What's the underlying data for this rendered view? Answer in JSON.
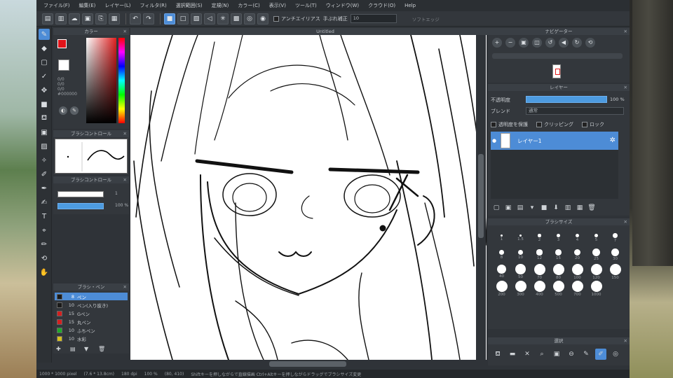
{
  "menu": [
    "ファイル(F)",
    "編集(E)",
    "レイヤー(L)",
    "フィルタ(R)",
    "選択範囲(S)",
    "定規(N)",
    "カラー(C)",
    "表示(V)",
    "ツール(T)",
    "ウィンドウ(W)",
    "クラウド(O)",
    "Help"
  ],
  "toolbar": {
    "antialias_label": "アンチエイリアス",
    "correction_label": "手ぶれ補正",
    "correction_value": "10",
    "soft_label": "ソフトエッジ"
  },
  "panels": {
    "color": "カラー",
    "brush_control": "ブラシコントロール",
    "brush_list": "ブラシ・ペン",
    "navigator": "ナビゲーター",
    "layer": "レイヤー",
    "brush_size": "ブラシサイズ",
    "nav_bottom": "選択"
  },
  "color": {
    "rgb": [
      "0/0",
      "0/0",
      "0/0"
    ],
    "hex": "#000000"
  },
  "cursor_opacity": "100 %",
  "cursor_size": "1",
  "canvas": {
    "title": "Untitled"
  },
  "pens": [
    {
      "size": "8",
      "name": "ペン",
      "color": "#1a1a1a",
      "active": true
    },
    {
      "size": "10",
      "name": "ペン(入り抜き)",
      "color": "#1a1a1a",
      "active": false
    },
    {
      "size": "15",
      "name": "Gペン",
      "color": "#d42020",
      "active": false
    },
    {
      "size": "15",
      "name": "丸ペン",
      "color": "#d42020",
      "active": false
    },
    {
      "size": "10",
      "name": "ふちペン",
      "color": "#1faa2a",
      "active": false
    },
    {
      "size": "10",
      "name": "水彩",
      "color": "#d6c020",
      "active": false
    }
  ],
  "layer": {
    "opacity_label": "不透明度",
    "opacity_value": "100 %",
    "blend_label": "ブレンド",
    "blend_value": "通常",
    "protect_label": "透明度を保護",
    "clipping_label": "クリッピング",
    "lock_label": "ロック",
    "name": "レイヤー1"
  },
  "brush_sizes": [
    "1",
    "1.5",
    "2",
    "3",
    "4",
    "5",
    "7",
    "8",
    "10",
    "12",
    "15",
    "20",
    "25",
    "30",
    "40",
    "50",
    "70",
    "80",
    "100",
    "120",
    "150",
    "200",
    "300",
    "400",
    "500",
    "700",
    "1000"
  ],
  "status": {
    "dims": "1000 * 1000 pixel",
    "cm": "(7.6 * 13.8cm)",
    "dpi": "180 dpi",
    "zoom": "100 %",
    "coords": "(80, 410)",
    "hint": "Shiftキーを押しながらで直線描画 Ctrl+Altキーを押しながらドラッグでブラシサイズ変更"
  }
}
